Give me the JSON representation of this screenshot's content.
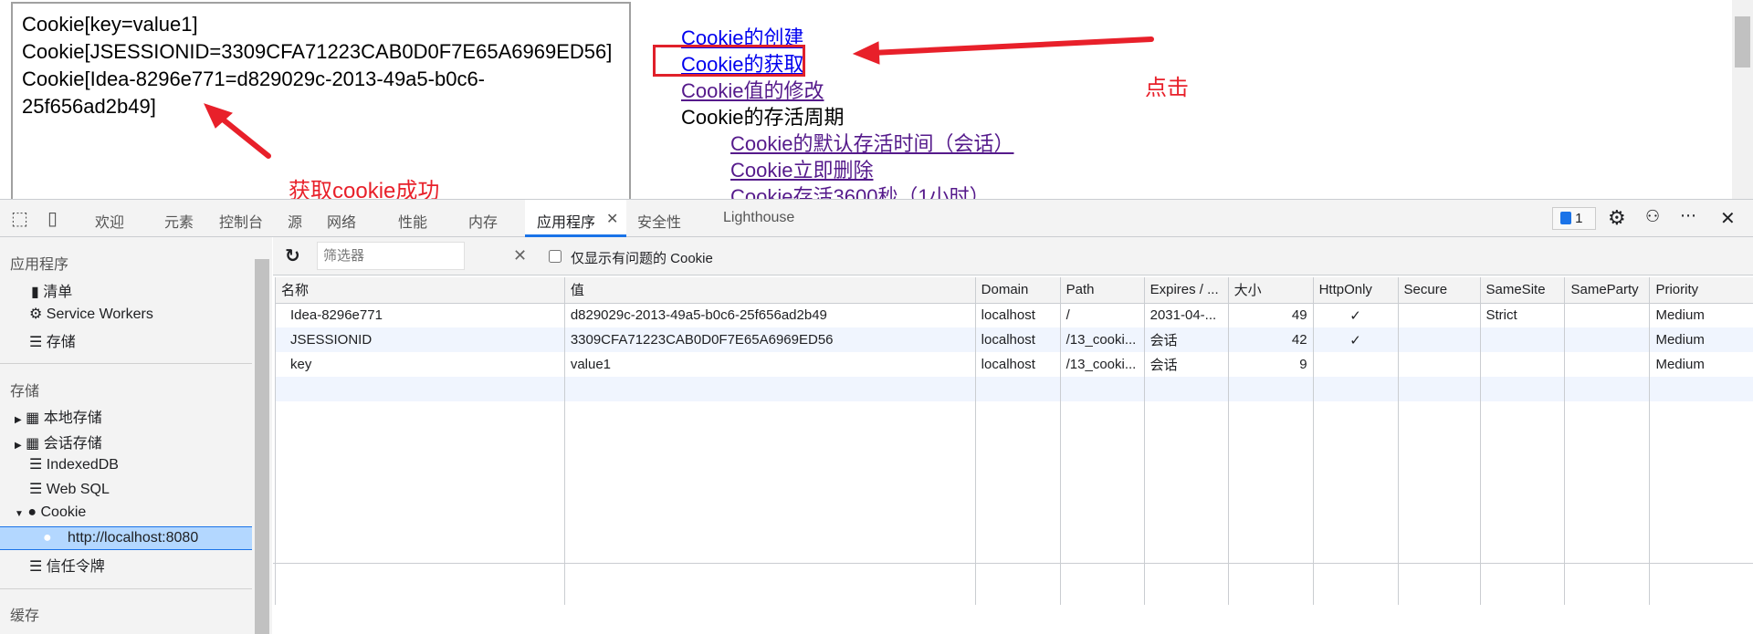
{
  "page": {
    "frame_lines": [
      "Cookie[key=value1]",
      "Cookie[JSESSIONID=3309CFA71223CAB0D0F7E65A6969ED56]",
      "Cookie[Idea-8296e771=d829029c-2013-49a5-b0c6-",
      "25f656ad2b49]"
    ],
    "annotation_left": "获取cookie成功",
    "annotation_right": "点击",
    "links": [
      "Cookie的创建",
      "Cookie的获取",
      "Cookie值的修改"
    ],
    "section": "Cookie的存活周期",
    "sublinks": [
      "Cookie的默认存活时间（会话）",
      "Cookie立即删除",
      "Cookie存活3600秒（1小时）"
    ],
    "annotation_color": "#e8202a"
  },
  "devtools": {
    "tabs": [
      "欢迎",
      "元素",
      "控制台",
      "源",
      "网络",
      "性能",
      "内存",
      "应用程序",
      "安全性",
      "Lighthouse"
    ],
    "active_tab": "应用程序",
    "issues_count": "1",
    "accent": "#1a73e8"
  },
  "sidebar": {
    "app_header": "应用程序",
    "app_items": [
      "清单",
      "Service Workers",
      "存储"
    ],
    "storage_header": "存储",
    "storage_items": [
      "本地存储",
      "会话存储",
      "IndexedDB",
      "Web SQL",
      "Cookie"
    ],
    "cookie_origin": "http://localhost:8080",
    "trust_tokens": "信任令牌",
    "cache_header": "缓存"
  },
  "toolbar": {
    "filter_placeholder": "筛选器",
    "only_issues_label": "仅显示有问题的 Cookie"
  },
  "table": {
    "columns": [
      "名称",
      "值",
      "Domain",
      "Path",
      "Expires / ...",
      "大小",
      "HttpOnly",
      "Secure",
      "SameSite",
      "SameParty",
      "Priority"
    ],
    "rows": [
      [
        "Idea-8296e771",
        "d829029c-2013-49a5-b0c6-25f656ad2b49",
        "localhost",
        "/",
        "2031-04-...",
        "49",
        "✓",
        "",
        "Strict",
        "",
        "Medium"
      ],
      [
        "JSESSIONID",
        "3309CFA71223CAB0D0F7E65A6969ED56",
        "localhost",
        "/13_cooki...",
        "会话",
        "42",
        "✓",
        "",
        "",
        "",
        "Medium"
      ],
      [
        "key",
        "value1",
        "localhost",
        "/13_cooki...",
        "会话",
        "9",
        "",
        "",
        "",
        "",
        "Medium"
      ]
    ]
  }
}
